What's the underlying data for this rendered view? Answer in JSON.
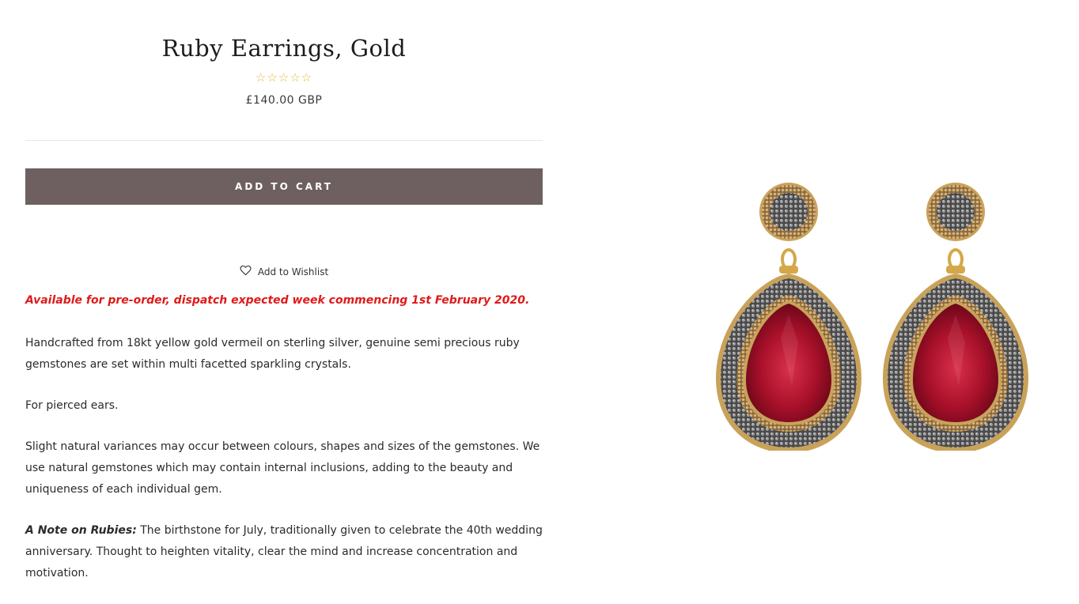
{
  "product": {
    "title": "Ruby Earrings, Gold",
    "stars": "☆☆☆☆☆",
    "rating": 0,
    "price": "£140.00 GBP"
  },
  "actions": {
    "add_to_cart": "ADD TO CART",
    "wishlist": "Add to Wishlist"
  },
  "notice": "Available for pre-order, dispatch expected week commencing 1st February 2020.",
  "description": {
    "p1": "Handcrafted from 18kt yellow gold vermeil on sterling silver, genuine semi precious ruby gemstones are set within multi facetted sparkling crystals.",
    "p2": "For pierced ears.",
    "p3": "Slight natural variances may occur between colours, shapes and sizes of the gemstones. We use natural gemstones which may contain internal inclusions, adding to the beauty and uniqueness of each individual gem.",
    "p4_label": "A Note on Rubies:",
    "p4_text": " The birthstone for July, traditionally given to celebrate the 40th wedding anniversary. Thought to heighten vitality, clear the mind and increase concentration and motivation."
  },
  "colors": {
    "button": "#6e6060",
    "notice": "#e01a1a",
    "stars": "#e2b93b",
    "ruby": "#a8102a"
  },
  "icons": {
    "wishlist": "heart-icon",
    "rating": "star-icon"
  }
}
